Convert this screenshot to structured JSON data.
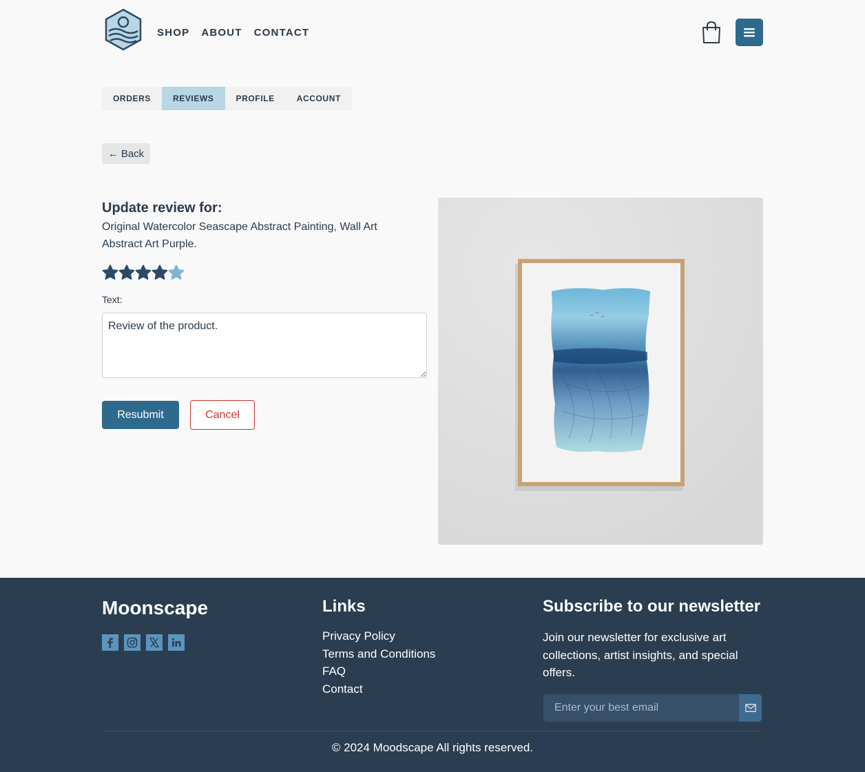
{
  "header": {
    "nav": [
      "SHOP",
      "ABOUT",
      "CONTACT"
    ]
  },
  "tabs": [
    {
      "label": "ORDERS",
      "active": false
    },
    {
      "label": "REVIEWS",
      "active": true
    },
    {
      "label": "PROFILE",
      "active": false
    },
    {
      "label": "ACCOUNT",
      "active": false
    }
  ],
  "back_label": "Back",
  "review_form": {
    "title": "Update review for:",
    "product_name": "Original Watercolor Seascape Abstract Painting, Wall Art Abstract Art Purple.",
    "rating": 4,
    "rating_max": 5,
    "text_label": "Text:",
    "review_text": "Review of the product.",
    "submit_label": "Resubmit",
    "cancel_label": "Cancel"
  },
  "colors": {
    "primary": "#2e6a8e",
    "star_filled": "#2b4a66",
    "star_empty": "#7fb4d4",
    "danger": "#d3322b",
    "footer_bg": "#2b3d50",
    "tab_active": "#b8d6e3"
  },
  "footer": {
    "brand": "Moonscape",
    "socials": [
      "facebook-icon",
      "instagram-icon",
      "x-icon",
      "linkedin-icon"
    ],
    "links_title": "Links",
    "links": [
      "Privacy Policy",
      "Terms and Conditions",
      "FAQ",
      "Contact"
    ],
    "newsletter_title": "Subscribe to our newsletter",
    "newsletter_text": "Join our newsletter for exclusive art collections, artist insights, and special offers.",
    "email_placeholder": "Enter your best email",
    "copyright": "© 2024 Moodscape All rights reserved."
  }
}
